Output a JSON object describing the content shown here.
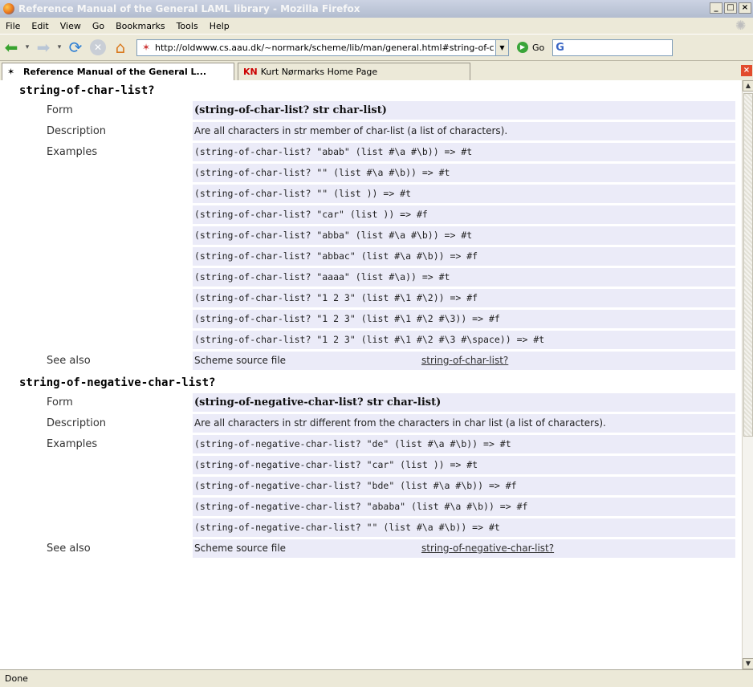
{
  "window": {
    "title": "Reference Manual of the General LAML library - Mozilla Firefox",
    "controls": [
      "_",
      "□",
      "×"
    ]
  },
  "menu": [
    "File",
    "Edit",
    "View",
    "Go",
    "Bookmarks",
    "Tools",
    "Help"
  ],
  "nav": {
    "url": "http://oldwww.cs.aau.dk/~normark/scheme/lib/man/general.html#string-of-c",
    "go_label": "Go",
    "search_logo": "G"
  },
  "tabs": [
    {
      "label": "Reference Manual of the General L..."
    },
    {
      "icon_text": "KN",
      "label": "Kurt Nørmarks Home Page"
    }
  ],
  "labels": {
    "form": "Form",
    "description": "Description",
    "examples": "Examples",
    "see_also": "See also",
    "source_file": "Scheme source file"
  },
  "entries": [
    {
      "name": "string-of-char-list?",
      "form": "(string-of-char-list? str char-list)",
      "description": "Are all characters in str member of char-list (a list of characters).",
      "examples": [
        "(string-of-char-list? \"abab\" (list #\\a #\\b)) => #t",
        "(string-of-char-list? \"\" (list #\\a #\\b)) => #t",
        "(string-of-char-list? \"\" (list )) => #t",
        "(string-of-char-list? \"car\" (list )) => #f",
        "(string-of-char-list? \"abba\" (list #\\a #\\b)) => #t",
        "(string-of-char-list? \"abbac\" (list #\\a #\\b)) => #f",
        "(string-of-char-list? \"aaaa\" (list #\\a)) => #t",
        "(string-of-char-list? \"1 2 3\" (list #\\1 #\\2)) => #f",
        "(string-of-char-list? \"1 2 3\" (list #\\1 #\\2 #\\3)) => #f",
        "(string-of-char-list? \"1 2 3\" (list #\\1 #\\2 #\\3 #\\space)) => #t"
      ],
      "see_also_link": "string-of-char-list?"
    },
    {
      "name": "string-of-negative-char-list?",
      "form": "(string-of-negative-char-list? str char-list)",
      "description": "Are all characters in str different from the characters in char list (a list of characters).",
      "examples": [
        "(string-of-negative-char-list? \"de\" (list #\\a #\\b)) => #t",
        "(string-of-negative-char-list? \"car\" (list )) => #t",
        "(string-of-negative-char-list? \"bde\" (list #\\a #\\b)) => #f",
        "(string-of-negative-char-list? \"ababa\" (list #\\a #\\b)) => #f",
        "(string-of-negative-char-list? \"\" (list #\\a #\\b)) => #t"
      ],
      "see_also_link": "string-of-negative-char-list?"
    }
  ],
  "status": "Done"
}
